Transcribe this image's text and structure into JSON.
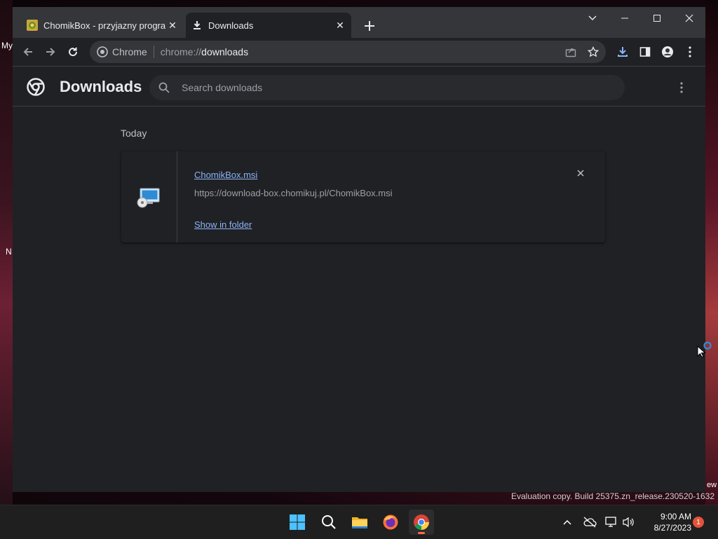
{
  "desktop": {
    "left_labels": [
      "My",
      "N"
    ],
    "right_label": "ew",
    "eval_text": "Evaluation copy. Build 25375.zn_release.230520-1632"
  },
  "tabs": [
    {
      "title": "ChomikBox - przyjazny program",
      "icon": "chomikbox-favicon",
      "active": false
    },
    {
      "title": "Downloads",
      "icon": "download-icon",
      "active": true
    }
  ],
  "omnibox": {
    "chip": "Chrome",
    "url_scheme": "chrome://",
    "url_host": "downloads"
  },
  "page": {
    "title": "Downloads",
    "search_placeholder": "Search downloads"
  },
  "downloads": {
    "date_heading": "Today",
    "items": [
      {
        "file_name": "ChomikBox.msi",
        "url": "https://download-box.chomikuj.pl/ChomikBox.msi",
        "action": "Show in folder"
      }
    ]
  },
  "taskbar": {
    "apps": [
      "start-icon",
      "search-icon",
      "file-explorer-icon",
      "firefox-icon",
      "chrome-icon"
    ],
    "time": "9:00 AM",
    "date": "8/27/2023",
    "notification_count": "1"
  },
  "colors": {
    "accent": "#8ab4f8",
    "background": "#202124",
    "tab_strip": "#35363a"
  }
}
